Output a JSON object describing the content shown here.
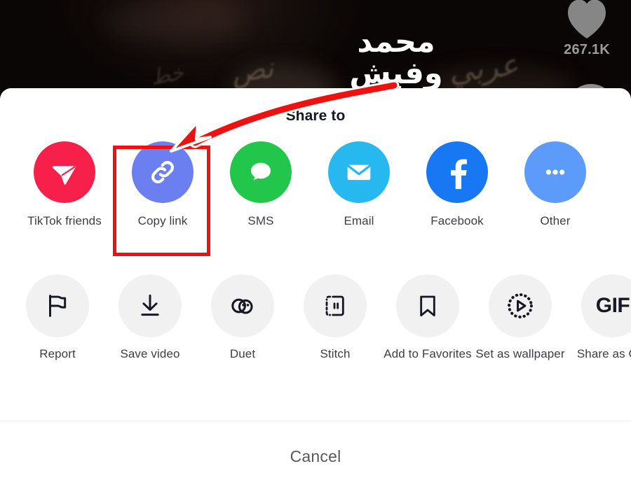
{
  "video": {
    "channel_logo_text": "محمد وفيش",
    "like_count": "267.1K",
    "like_icon": "heart-icon",
    "avatar_icon": "profile-avatar",
    "background_script_1": "نص",
    "background_script_2": "عربي",
    "background_script_3": "خط"
  },
  "sheet": {
    "title": "Share to",
    "cancel_label": "Cancel",
    "share_targets": [
      {
        "label": "TikTok friends",
        "icon": "send-plane-icon",
        "circle_color": "#f6204a",
        "icon_color": "#ffffff"
      },
      {
        "label": "Copy link",
        "icon": "chain-link-icon",
        "circle_color": "#6b7ff0",
        "icon_color": "#ffffff"
      },
      {
        "label": "SMS",
        "icon": "speech-bubble-icon",
        "circle_color": "#22c64b",
        "icon_color": "#ffffff"
      },
      {
        "label": "Email",
        "icon": "envelope-icon",
        "circle_color": "#27b8ef",
        "icon_color": "#ffffff"
      },
      {
        "label": "Facebook",
        "icon": "facebook-f-icon",
        "circle_color": "#1877f2",
        "icon_color": "#ffffff"
      },
      {
        "label": "Other",
        "icon": "ellipsis-icon",
        "circle_color": "#5d9bfb",
        "icon_color": "#ffffff"
      }
    ],
    "actions": [
      {
        "label": "Report",
        "icon": "flag-icon"
      },
      {
        "label": "Save video",
        "icon": "download-icon"
      },
      {
        "label": "Duet",
        "icon": "duet-circles-icon"
      },
      {
        "label": "Stitch",
        "icon": "stitch-frame-icon"
      },
      {
        "label": "Add to Favorites",
        "icon": "bookmark-icon"
      },
      {
        "label": "Set as wallpaper",
        "icon": "play-dotted-circle-icon"
      },
      {
        "label": "Share as GIF",
        "icon": "gif-text-icon",
        "icon_text": "GIF"
      }
    ]
  },
  "annotations": {
    "arrow": {
      "color": "#ee1111",
      "outline_color": "#ffffff",
      "points_to": "copy-link-button"
    },
    "highlight_box": {
      "color": "#ee1111",
      "target": "copy-link-button"
    }
  }
}
